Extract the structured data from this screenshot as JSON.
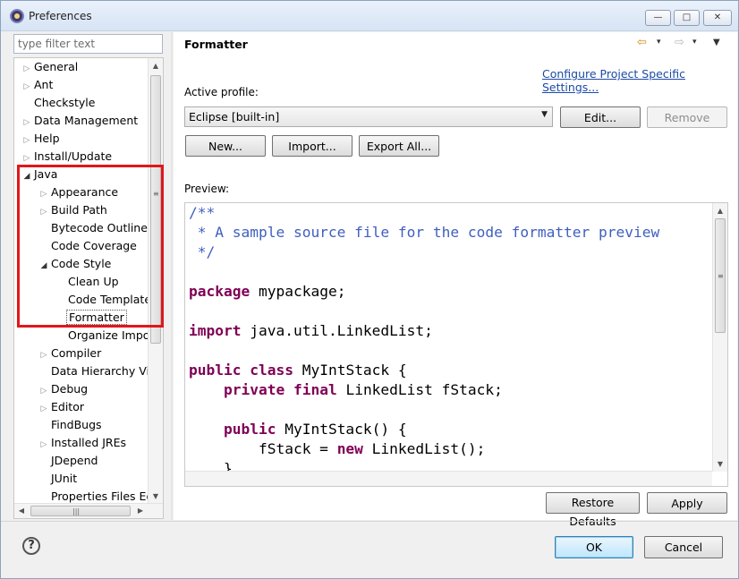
{
  "window": {
    "title": "Preferences",
    "controls": {
      "minimize": "—",
      "maximize": "□",
      "close": "✕"
    }
  },
  "sidebar": {
    "filter_placeholder": "type filter text",
    "items": [
      {
        "label": "General",
        "expander": "▷"
      },
      {
        "label": "Ant",
        "expander": "▷"
      },
      {
        "label": "Checkstyle",
        "expander": ""
      },
      {
        "label": "Data Management",
        "expander": "▷"
      },
      {
        "label": "Help",
        "expander": "▷"
      },
      {
        "label": "Install/Update",
        "expander": "▷"
      },
      {
        "label": "Java",
        "expander": "◢"
      },
      {
        "label": "Appearance",
        "expander": "▷"
      },
      {
        "label": "Build Path",
        "expander": "▷"
      },
      {
        "label": "Bytecode Outline",
        "expander": ""
      },
      {
        "label": "Code Coverage",
        "expander": ""
      },
      {
        "label": "Code Style",
        "expander": "◢"
      },
      {
        "label": "Clean Up",
        "expander": ""
      },
      {
        "label": "Code Templates",
        "expander": ""
      },
      {
        "label": "Formatter",
        "expander": ""
      },
      {
        "label": "Organize Imports",
        "expander": ""
      },
      {
        "label": "Compiler",
        "expander": "▷"
      },
      {
        "label": "Data Hierarchy View",
        "expander": ""
      },
      {
        "label": "Debug",
        "expander": "▷"
      },
      {
        "label": "Editor",
        "expander": "▷"
      },
      {
        "label": "FindBugs",
        "expander": ""
      },
      {
        "label": "Installed JREs",
        "expander": "▷"
      },
      {
        "label": "JDepend",
        "expander": ""
      },
      {
        "label": "JUnit",
        "expander": ""
      },
      {
        "label": "Properties Files Editor",
        "expander": ""
      }
    ],
    "selected": "Formatter"
  },
  "scroll_glyphs": {
    "up": "▲",
    "down": "▼",
    "left": "◀",
    "right": "▶",
    "grip_v": "≡",
    "grip_h": "|||"
  },
  "page": {
    "title": "Formatter",
    "nav": {
      "back": "⇦",
      "forward": "⇨",
      "dropdown": "▾",
      "menu": "▼"
    },
    "configure_link": "Configure Project Specific Settings...",
    "active_profile_label": "Active profile:",
    "profile_value": "Eclipse [built-in]",
    "combo_arrow": "▼",
    "buttons": {
      "edit": "Edit...",
      "remove": "Remove",
      "new": "New...",
      "import": "Import...",
      "export_all": "Export All...",
      "restore_defaults": "Restore Defaults",
      "apply": "Apply"
    },
    "preview_label": "Preview:"
  },
  "preview_code": [
    [
      [
        "cm",
        "/**"
      ]
    ],
    [
      [
        "cm",
        " * A sample source file for the code formatter preview"
      ]
    ],
    [
      [
        "cm",
        " */"
      ]
    ],
    [],
    [
      [
        "kw",
        "package"
      ],
      [
        "tx",
        " mypackage;"
      ]
    ],
    [],
    [
      [
        "kw",
        "import"
      ],
      [
        "tx",
        " java.util.LinkedList;"
      ]
    ],
    [],
    [
      [
        "kw",
        "public"
      ],
      [
        "tx",
        " "
      ],
      [
        "kw",
        "class"
      ],
      [
        "tx",
        " MyIntStack {"
      ]
    ],
    [
      [
        "tx",
        "    "
      ],
      [
        "kw",
        "private"
      ],
      [
        "tx",
        " "
      ],
      [
        "kw",
        "final"
      ],
      [
        "tx",
        " LinkedList fStack;"
      ]
    ],
    [],
    [
      [
        "tx",
        "    "
      ],
      [
        "kw",
        "public"
      ],
      [
        "tx",
        " MyIntStack() {"
      ]
    ],
    [
      [
        "tx",
        "        fStack = "
      ],
      [
        "kw",
        "new"
      ],
      [
        "tx",
        " LinkedList();"
      ]
    ],
    [
      [
        "tx",
        "    }"
      ]
    ]
  ],
  "footer": {
    "help_icon": "?",
    "ok": "OK",
    "cancel": "Cancel"
  },
  "colors": {
    "comment": "#3f5fbf",
    "keyword": "#7f0055",
    "link": "#1b4aa6",
    "highlight_box": "#e1161b"
  }
}
